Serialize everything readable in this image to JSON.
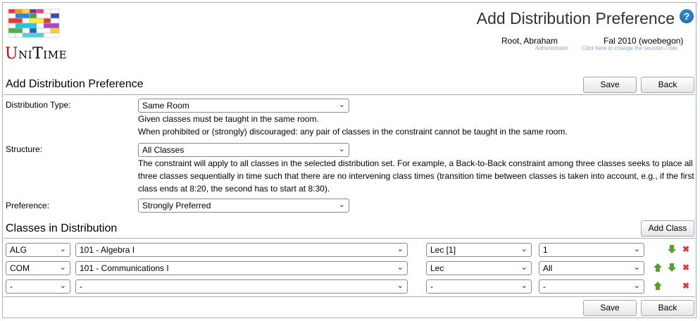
{
  "app": {
    "logo_text": "UniTime"
  },
  "header": {
    "title": "Add Distribution Preference",
    "user_name": "Root, Abraham",
    "user_role": "Administrator",
    "session": "Fal 2010 (woebegon)",
    "session_hint": "Click here to change the session / role."
  },
  "form": {
    "section_title": "Add Distribution Preference",
    "save_label": "Save",
    "back_label": "Back",
    "distribution_type_label": "Distribution Type:",
    "distribution_type_value": "Same Room",
    "distribution_type_desc_1": "Given classes must be taught in the same room.",
    "distribution_type_desc_2": "When prohibited or (strongly) discouraged: any pair of classes in the constraint cannot be taught in the same room.",
    "structure_label": "Structure:",
    "structure_value": "All Classes",
    "structure_desc": "The constraint will apply to all classes in the selected distribution set. For example, a Back-to-Back constraint among three classes seeks to place all three classes sequentially in time such that there are no intervening class times (transition time between classes is taken into account, e.g., if the first class ends at 8:20, the second has to start at 8:30).",
    "preference_label": "Preference:",
    "preference_value": "Strongly Preferred"
  },
  "classes": {
    "section_title": "Classes in Distribution",
    "add_class_label": "Add Class",
    "rows": [
      {
        "subject": "ALG",
        "course": "101 - Algebra I",
        "subpart": "Lec [1]",
        "cls": "1"
      },
      {
        "subject": "COM",
        "course": "101 - Communications I",
        "subpart": "Lec",
        "cls": "All"
      },
      {
        "subject": "-",
        "course": "-",
        "subpart": "-",
        "cls": "-"
      }
    ]
  },
  "footer": {
    "save_label": "Save",
    "back_label": "Back"
  },
  "icons": {
    "help": "help-icon",
    "up": "arrow-up-icon",
    "down": "arrow-down-icon",
    "delete": "delete-icon"
  },
  "colors": {
    "accent": "#2f7fc9",
    "border": "#9cb0ce",
    "arrow": "#5a9e2f",
    "delete": "#d63a3a"
  }
}
